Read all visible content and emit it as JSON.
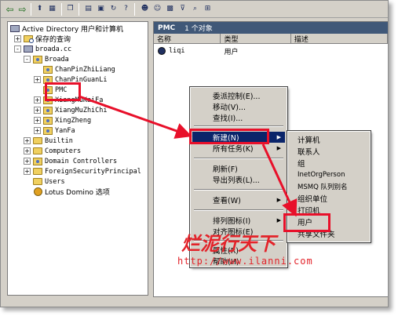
{
  "toolbar": {
    "buttons": [
      "back-icon",
      "forward-icon",
      "up-icon",
      "show-tree-icon",
      "copy-icon",
      "properties-icon",
      "export-icon",
      "help-icon",
      "refresh-icon",
      "add-user-icon",
      "add-group-icon",
      "add-ou-icon",
      "filter-icon",
      "find-icon",
      "add-to-group-icon"
    ]
  },
  "tree": {
    "items": [
      {
        "label": "Active Directory 用户和计算机",
        "icon": "computer-icon",
        "expander": ""
      },
      {
        "label": "保存的查询",
        "icon": "saved-query-icon",
        "expander": "+"
      },
      {
        "label": "broada.cc",
        "icon": "domain-icon",
        "expander": "-"
      },
      {
        "label": "Broada",
        "icon": "ou-icon",
        "expander": "-"
      },
      {
        "label": "ChanPinZhiLiang",
        "icon": "ou-icon",
        "expander": ""
      },
      {
        "label": "ChanPinGuanLi",
        "icon": "ou-icon",
        "expander": "+"
      },
      {
        "label": "PMC",
        "icon": "ou-icon",
        "expander": ""
      },
      {
        "label": "XiangMuKaiFa",
        "icon": "ou-icon",
        "expander": "+"
      },
      {
        "label": "XiangMuZhiChi",
        "icon": "ou-icon",
        "expander": "+"
      },
      {
        "label": "XingZheng",
        "icon": "ou-icon",
        "expander": "+"
      },
      {
        "label": "YanFa",
        "icon": "ou-icon",
        "expander": "+"
      },
      {
        "label": "Builtin",
        "icon": "folder-icon",
        "expander": "+"
      },
      {
        "label": "Computers",
        "icon": "folder-icon",
        "expander": "+"
      },
      {
        "label": "Domain Controllers",
        "icon": "ou-icon",
        "expander": "+"
      },
      {
        "label": "ForeignSecurityPrincipal",
        "icon": "folder-icon",
        "expander": "+"
      },
      {
        "label": "Users",
        "icon": "folder-icon",
        "expander": ""
      },
      {
        "label": "Lotus Domino 选项",
        "icon": "lotus-icon",
        "expander": ""
      }
    ]
  },
  "right": {
    "title": "PMC",
    "count": "1 个对象",
    "columns": [
      "名称",
      "类型",
      "描述"
    ],
    "rows": [
      {
        "name": "liqi",
        "type": "用户",
        "desc": ""
      }
    ]
  },
  "context_menu": {
    "items": [
      "委派控制(E)...",
      "移动(V)...",
      "查找(I)...",
      "新建(N)",
      "所有任务(K)",
      "刷新(F)",
      "导出列表(L)...",
      "查看(W)",
      "排列图标(I)",
      "对齐图标(E)",
      "属性(R)",
      "帮助(H)"
    ],
    "highlighted": "新建(N)"
  },
  "submenu": {
    "items": [
      "计算机",
      "联系人",
      "组",
      "InetOrgPerson",
      "MSMQ 队列别名",
      "组织单位",
      "打印机",
      "用户",
      "共享文件夹"
    ],
    "highlighted": "用户"
  },
  "watermark": {
    "title": "烂泥行天下",
    "url": "http://www.ilanni.com"
  },
  "colors": {
    "highlight_box": "#e8102a",
    "menu_selection": "#0a246a",
    "watermark": "#e3232a"
  }
}
